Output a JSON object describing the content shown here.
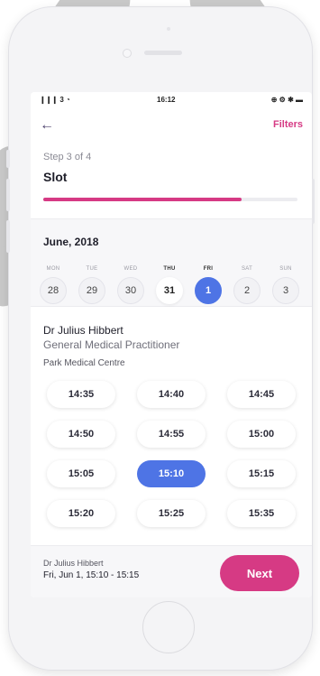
{
  "statusbar": {
    "signal": "❙❙❙ 3 ◔",
    "time": "16:12",
    "icons": "⊕ ⚙ ✱ ▬"
  },
  "nav": {
    "back_icon": "arrow-left-icon",
    "back_glyph": "←",
    "filters_label": "Filters"
  },
  "step": {
    "text": "Step 3 of 4",
    "title": "Slot",
    "progress": 0.78
  },
  "calendar": {
    "month": "June, 2018",
    "days": [
      {
        "dow": "MON",
        "date": "28",
        "state": "normal"
      },
      {
        "dow": "TUE",
        "date": "29",
        "state": "normal"
      },
      {
        "dow": "WED",
        "date": "30",
        "state": "normal"
      },
      {
        "dow": "THU",
        "date": "31",
        "state": "today"
      },
      {
        "dow": "FRI",
        "date": "1",
        "state": "selected"
      },
      {
        "dow": "SAT",
        "date": "2",
        "state": "normal"
      },
      {
        "dow": "SUN",
        "date": "3",
        "state": "normal"
      }
    ]
  },
  "doctor": {
    "name": "Dr Julius Hibbert",
    "role": "General Medical Practitioner",
    "place": "Park Medical Centre"
  },
  "times": [
    {
      "label": "14:35",
      "selected": false
    },
    {
      "label": "14:40",
      "selected": false
    },
    {
      "label": "14:45",
      "selected": false
    },
    {
      "label": "14:50",
      "selected": false
    },
    {
      "label": "14:55",
      "selected": false
    },
    {
      "label": "15:00",
      "selected": false
    },
    {
      "label": "15:05",
      "selected": false
    },
    {
      "label": "15:10",
      "selected": true
    },
    {
      "label": "15:15",
      "selected": false
    },
    {
      "label": "15:20",
      "selected": false
    },
    {
      "label": "15:25",
      "selected": false
    },
    {
      "label": "15:35",
      "selected": false
    }
  ],
  "summary": {
    "name": "Dr Julius Hibbert",
    "slot": "Fri, Jun 1, 15:10 - 15:15"
  },
  "actions": {
    "next_label": "Next"
  },
  "colors": {
    "accent": "#d63a84",
    "selected": "#4e74e5"
  }
}
